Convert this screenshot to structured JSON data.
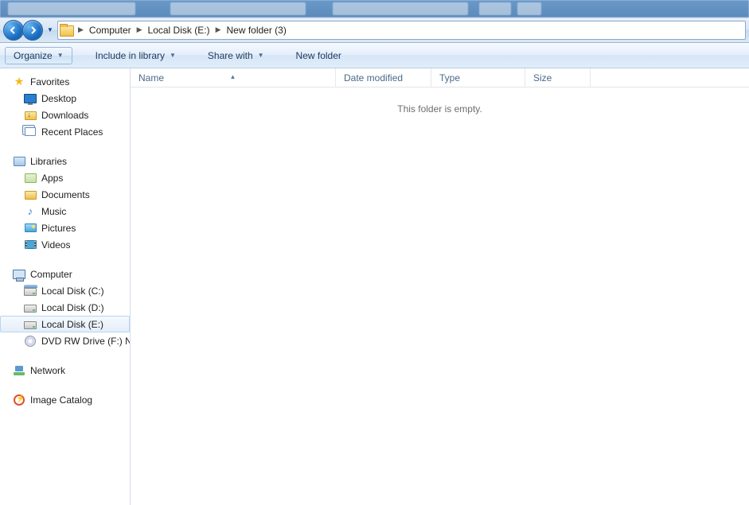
{
  "breadcrumb": {
    "items": [
      "Computer",
      "Local Disk (E:)",
      "New folder (3)"
    ]
  },
  "toolbar": {
    "organize": "Organize",
    "include_library": "Include in library",
    "share_with": "Share with",
    "new_folder": "New folder"
  },
  "sidebar": {
    "favorites": {
      "header": "Favorites",
      "items": [
        "Desktop",
        "Downloads",
        "Recent Places"
      ]
    },
    "libraries": {
      "header": "Libraries",
      "items": [
        "Apps",
        "Documents",
        "Music",
        "Pictures",
        "Videos"
      ]
    },
    "computer": {
      "header": "Computer",
      "items": [
        "Local Disk (C:)",
        "Local Disk (D:)",
        "Local Disk (E:)",
        "DVD RW Drive (F:)  N"
      ]
    },
    "network": {
      "header": "Network"
    },
    "catalog": {
      "header": "Image Catalog"
    }
  },
  "columns": {
    "name": "Name",
    "modified": "Date modified",
    "type": "Type",
    "size": "Size"
  },
  "content": {
    "empty": "This folder is empty."
  }
}
